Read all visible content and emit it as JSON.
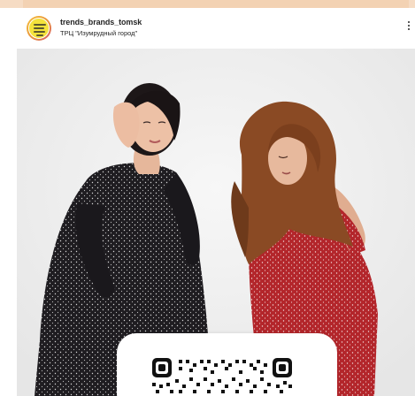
{
  "post": {
    "username": "trends_brands_tomsk",
    "location": "ТРЦ \"Изумрудный город\""
  },
  "colors": {
    "avatar_bg": "#f4e23c",
    "left_dress": "#1f1d21",
    "right_dress": "#b3262b",
    "background": "#efefef"
  },
  "icons": [
    "more-options-icon",
    "avatar-logo-icon",
    "qr-code-icon"
  ]
}
